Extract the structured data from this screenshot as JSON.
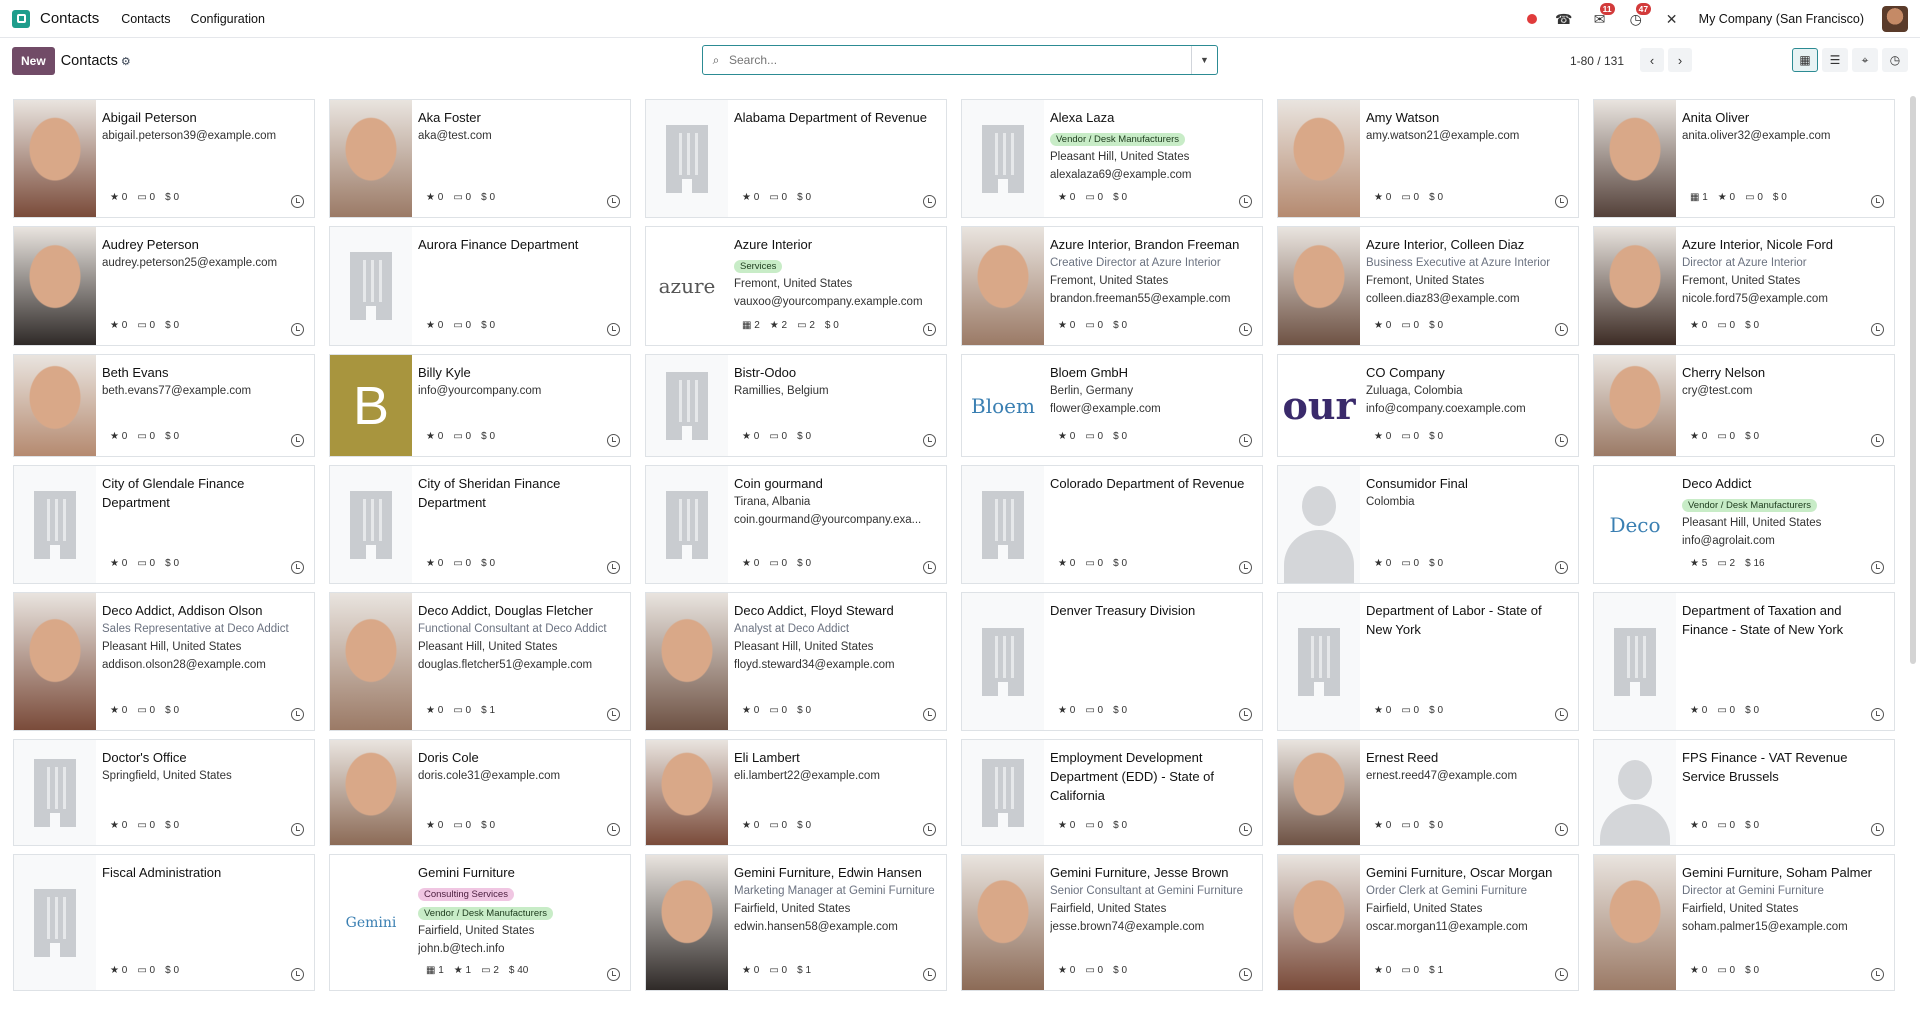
{
  "topbar": {
    "brand": "Contacts",
    "menus": [
      "Contacts",
      "Configuration"
    ],
    "messages_badge": "11",
    "activities_badge": "47",
    "company": "My Company (San Francisco)"
  },
  "control": {
    "new_label": "New",
    "breadcrumb": "Contacts",
    "search_placeholder": "Search...",
    "pager": "1-80 / 131"
  },
  "colors": {
    "accent": "#714b67",
    "teal": "#2c8b93",
    "tag_green": "#c8ecc7",
    "tag_pink": "#f0c6e2"
  },
  "cards": [
    {
      "name": "Abigail Peterson",
      "img": "photo",
      "lines": [
        "abigail.peterson39@example.com"
      ],
      "stats": [
        "★ 0",
        "▭ 0",
        "$ 0"
      ]
    },
    {
      "name": "Aka Foster",
      "img": "photo",
      "lines": [
        "aka@test.com"
      ],
      "stats": [
        "★ 0",
        "▭ 0",
        "$ 0"
      ]
    },
    {
      "name": "Alabama Department of Revenue",
      "img": "building",
      "lines": [],
      "stats": [
        "★ 0",
        "▭ 0",
        "$ 0"
      ]
    },
    {
      "name": "Alexa Laza",
      "img": "building",
      "tags": [
        {
          "t": "Vendor / Desk Manufacturers",
          "c": "green"
        }
      ],
      "lines": [
        "Pleasant Hill, United States",
        "alexalaza69@example.com"
      ],
      "stats": [
        "★ 0",
        "▭ 0",
        "$ 0"
      ]
    },
    {
      "name": "Amy Watson",
      "img": "photo",
      "lines": [
        "amy.watson21@example.com"
      ],
      "stats": [
        "★ 0",
        "▭ 0",
        "$ 0"
      ]
    },
    {
      "name": "Anita Oliver",
      "img": "photo",
      "lines": [
        "anita.oliver32@example.com"
      ],
      "stats": [
        "▦ 1",
        "★ 0",
        "▭ 0",
        "$ 0"
      ]
    },
    {
      "name": "Audrey Peterson",
      "img": "photo",
      "lines": [
        "audrey.peterson25@example.com"
      ],
      "stats": [
        "★ 0",
        "▭ 0",
        "$ 0"
      ]
    },
    {
      "name": "Aurora Finance Department",
      "img": "building",
      "lines": [],
      "stats": [
        "★ 0",
        "▭ 0",
        "$ 0"
      ]
    },
    {
      "name": "Azure Interior",
      "img": "logo",
      "logo": "azure",
      "tags": [
        {
          "t": "Services",
          "c": "green"
        }
      ],
      "lines": [
        "Fremont, United States",
        "vauxoo@yourcompany.example.com"
      ],
      "stats": [
        "▦ 2",
        "★ 2",
        "▭ 2",
        "$ 0"
      ]
    },
    {
      "name": "Azure Interior, Brandon Freeman",
      "img": "photo",
      "lines": [
        "Creative Director at Azure Interior",
        "Fremont, United States",
        "brandon.freeman55@example.com"
      ],
      "muted": [
        0
      ],
      "stats": [
        "★ 0",
        "▭ 0",
        "$ 0"
      ]
    },
    {
      "name": "Azure Interior, Colleen Diaz",
      "img": "photo",
      "lines": [
        "Business Executive at Azure Interior",
        "Fremont, United States",
        "colleen.diaz83@example.com"
      ],
      "muted": [
        0
      ],
      "stats": [
        "★ 0",
        "▭ 0",
        "$ 0"
      ]
    },
    {
      "name": "Azure Interior, Nicole Ford",
      "img": "photo",
      "lines": [
        "Director at Azure Interior",
        "Fremont, United States",
        "nicole.ford75@example.com"
      ],
      "muted": [
        0
      ],
      "stats": [
        "★ 0",
        "▭ 0",
        "$ 0"
      ]
    },
    {
      "name": "Beth Evans",
      "img": "photo",
      "lines": [
        "beth.evans77@example.com"
      ],
      "stats": [
        "★ 0",
        "▭ 0",
        "$ 0"
      ]
    },
    {
      "name": "Billy Kyle",
      "img": "letter",
      "letter": "B",
      "lines": [
        "info@yourcompany.com"
      ],
      "stats": [
        "★ 0",
        "▭ 0",
        "$ 0"
      ]
    },
    {
      "name": "Bistr-Odoo",
      "img": "building",
      "lines": [
        "Ramillies, Belgium"
      ],
      "stats": [
        "★ 0",
        "▭ 0",
        "$ 0"
      ]
    },
    {
      "name": "Bloem GmbH",
      "img": "logo",
      "logo": "Bloem",
      "lines": [
        "Berlin, Germany",
        "flower@example.com"
      ],
      "stats": [
        "★ 0",
        "▭ 0",
        "$ 0"
      ]
    },
    {
      "name": "CO Company",
      "img": "logo",
      "logo": "our",
      "lines": [
        "Zuluaga, Colombia",
        "info@company.coexample.com"
      ],
      "stats": [
        "★ 0",
        "▭ 0",
        "$ 0"
      ]
    },
    {
      "name": "Cherry Nelson",
      "img": "photo",
      "lines": [
        "cry@test.com"
      ],
      "stats": [
        "★ 0",
        "▭ 0",
        "$ 0"
      ]
    },
    {
      "name": "City of Glendale Finance Department",
      "img": "building",
      "lines": [],
      "stats": [
        "★ 0",
        "▭ 0",
        "$ 0"
      ]
    },
    {
      "name": "City of Sheridan Finance Department",
      "img": "building",
      "lines": [],
      "stats": [
        "★ 0",
        "▭ 0",
        "$ 0"
      ]
    },
    {
      "name": "Coin gourmand",
      "img": "building",
      "lines": [
        "Tirana, Albania",
        "coin.gourmand@yourcompany.exa..."
      ],
      "stats": [
        "★ 0",
        "▭ 0",
        "$ 0"
      ]
    },
    {
      "name": "Colorado Department of Revenue",
      "img": "building",
      "lines": [],
      "stats": [
        "★ 0",
        "▭ 0",
        "$ 0"
      ]
    },
    {
      "name": "Consumidor Final",
      "img": "person",
      "lines": [
        "Colombia"
      ],
      "stats": [
        "★ 0",
        "▭ 0",
        "$ 0"
      ]
    },
    {
      "name": "Deco Addict",
      "img": "logo",
      "logo": "Deco",
      "tags": [
        {
          "t": "Vendor / Desk Manufacturers",
          "c": "green"
        }
      ],
      "lines": [
        "Pleasant Hill, United States",
        "info@agrolait.com"
      ],
      "stats": [
        "★ 5",
        "▭ 2",
        "$ 16"
      ]
    },
    {
      "name": "Deco Addict, Addison Olson",
      "img": "photo",
      "lines": [
        "Sales Representative at Deco Addict",
        "Pleasant Hill, United States",
        "addison.olson28@example.com"
      ],
      "muted": [
        0
      ],
      "stats": [
        "★ 0",
        "▭ 0",
        "$ 0"
      ]
    },
    {
      "name": "Deco Addict, Douglas Fletcher",
      "img": "photo",
      "lines": [
        "Functional Consultant at Deco Addict",
        "Pleasant Hill, United States",
        "douglas.fletcher51@example.com"
      ],
      "muted": [
        0
      ],
      "wrap": [
        0
      ],
      "stats": [
        "★ 0",
        "▭ 0",
        "$ 1"
      ]
    },
    {
      "name": "Deco Addict, Floyd Steward",
      "img": "photo",
      "lines": [
        "Analyst at Deco Addict",
        "Pleasant Hill, United States",
        "floyd.steward34@example.com"
      ],
      "muted": [
        0
      ],
      "stats": [
        "★ 0",
        "▭ 0",
        "$ 0"
      ]
    },
    {
      "name": "Denver Treasury Division",
      "img": "building",
      "lines": [],
      "stats": [
        "★ 0",
        "▭ 0",
        "$ 0"
      ]
    },
    {
      "name": "Department of Labor - State of New York",
      "img": "building",
      "lines": [],
      "stats": [
        "★ 0",
        "▭ 0",
        "$ 0"
      ]
    },
    {
      "name": "Department of Taxation and Finance - State of New York",
      "img": "building",
      "lines": [],
      "stats": [
        "★ 0",
        "▭ 0",
        "$ 0"
      ]
    },
    {
      "name": "Doctor's Office",
      "img": "building",
      "lines": [
        "Springfield, United States"
      ],
      "stats": [
        "★ 0",
        "▭ 0",
        "$ 0"
      ]
    },
    {
      "name": "Doris Cole",
      "img": "photo",
      "lines": [
        "doris.cole31@example.com"
      ],
      "stats": [
        "★ 0",
        "▭ 0",
        "$ 0"
      ]
    },
    {
      "name": "Eli Lambert",
      "img": "photo",
      "lines": [
        "eli.lambert22@example.com"
      ],
      "stats": [
        "★ 0",
        "▭ 0",
        "$ 0"
      ]
    },
    {
      "name": "Employment Development Department (EDD) - State of California",
      "img": "building",
      "lines": [],
      "stats": [
        "★ 0",
        "▭ 0",
        "$ 0"
      ]
    },
    {
      "name": "Ernest Reed",
      "img": "photo",
      "lines": [
        "ernest.reed47@example.com"
      ],
      "stats": [
        "★ 0",
        "▭ 0",
        "$ 0"
      ]
    },
    {
      "name": "FPS Finance - VAT Revenue Service Brussels",
      "img": "person",
      "lines": [],
      "stats": [
        "★ 0",
        "▭ 0",
        "$ 0"
      ]
    },
    {
      "name": "Fiscal Administration",
      "img": "building",
      "lines": [],
      "stats": [
        "★ 0",
        "▭ 0",
        "$ 0"
      ]
    },
    {
      "name": "Gemini Furniture",
      "img": "logo",
      "logo": "Gemini",
      "tags": [
        {
          "t": "Consulting Services",
          "c": "pink"
        },
        {
          "t": "Vendor / Desk Manufacturers",
          "c": "green"
        }
      ],
      "lines": [
        "Fairfield, United States",
        "john.b@tech.info"
      ],
      "stats": [
        "▦ 1",
        "★ 1",
        "▭ 2",
        "$ 40"
      ]
    },
    {
      "name": "Gemini Furniture, Edwin Hansen",
      "img": "photo",
      "lines": [
        "Marketing Manager at Gemini Furniture",
        "Fairfield, United States",
        "edwin.hansen58@example.com"
      ],
      "muted": [
        0
      ],
      "wrap": [
        0
      ],
      "stats": [
        "★ 0",
        "▭ 0",
        "$ 1"
      ]
    },
    {
      "name": "Gemini Furniture, Jesse Brown",
      "img": "photo",
      "lines": [
        "Senior Consultant at Gemini Furniture",
        "Fairfield, United States",
        "jesse.brown74@example.com"
      ],
      "muted": [
        0
      ],
      "wrap": [
        0
      ],
      "stats": [
        "★ 0",
        "▭ 0",
        "$ 0"
      ]
    },
    {
      "name": "Gemini Furniture, Oscar Morgan",
      "img": "photo",
      "lines": [
        "Order Clerk at Gemini Furniture",
        "Fairfield, United States",
        "oscar.morgan11@example.com"
      ],
      "muted": [
        0
      ],
      "stats": [
        "★ 0",
        "▭ 0",
        "$ 1"
      ]
    },
    {
      "name": "Gemini Furniture, Soham Palmer",
      "img": "photo",
      "lines": [
        "Director at Gemini Furniture",
        "Fairfield, United States",
        "soham.palmer15@example.com"
      ],
      "muted": [
        0
      ],
      "stats": [
        "★ 0",
        "▭ 0",
        "$ 0"
      ]
    }
  ]
}
